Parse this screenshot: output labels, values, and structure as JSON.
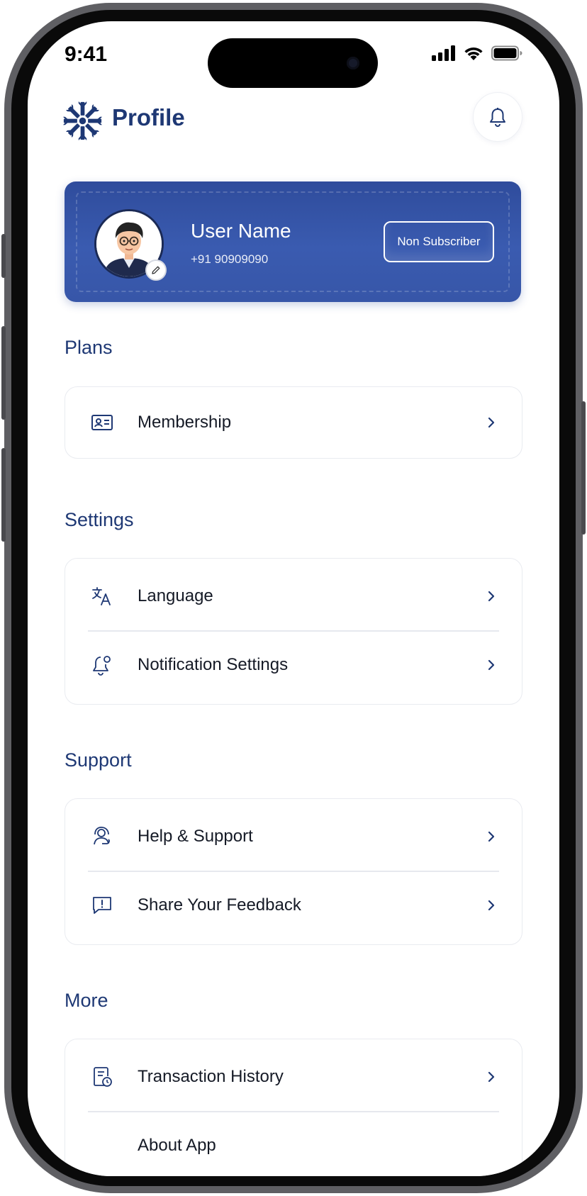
{
  "status_bar": {
    "time": "9:41"
  },
  "header": {
    "title": "Profile"
  },
  "profile": {
    "name": "User Name",
    "phone": "+91 90909090",
    "status": "Non Subscriber"
  },
  "sections": {
    "plans": {
      "title": "Plans",
      "items": [
        {
          "label": "Membership",
          "icon": "id-card-icon"
        }
      ]
    },
    "settings": {
      "title": "Settings",
      "items": [
        {
          "label": "Language",
          "icon": "translate-icon"
        },
        {
          "label": "Notification Settings",
          "icon": "bell-settings-icon"
        }
      ]
    },
    "support": {
      "title": "Support",
      "items": [
        {
          "label": "Help & Support",
          "icon": "headset-icon"
        },
        {
          "label": "Share Your Feedback",
          "icon": "feedback-icon"
        }
      ]
    },
    "more": {
      "title": "More",
      "items": [
        {
          "label": "Transaction History",
          "icon": "receipt-clock-icon"
        },
        {
          "label": "About App",
          "icon": "info-icon"
        }
      ]
    }
  },
  "colors": {
    "brand": "#1e3874",
    "card_blue": "#3a5bb0",
    "text": "#151a26"
  }
}
